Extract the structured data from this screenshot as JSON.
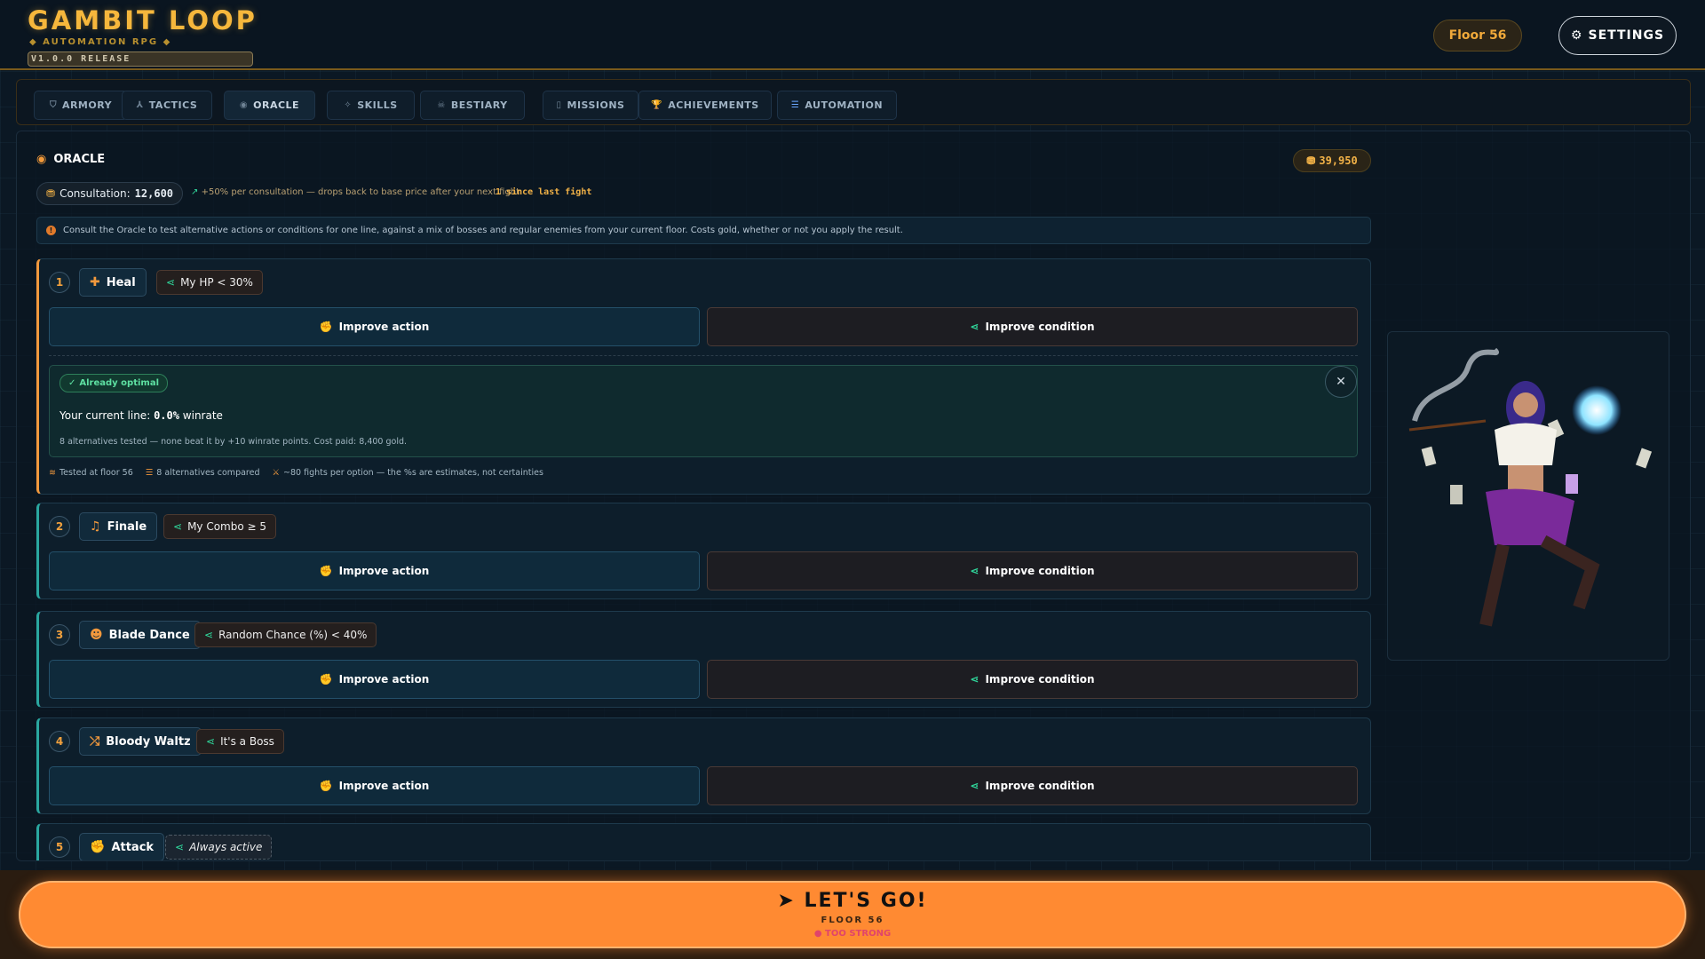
{
  "header": {
    "title": "GAMBIT LOOP",
    "subtitle": "◆ AUTOMATION RPG ◆",
    "version": "V1.0.0 RELEASE",
    "floor": "Floor 56",
    "settings_label": "SETTINGS"
  },
  "nav": {
    "tabs": [
      {
        "label": "ARMORY",
        "icon": "shield-icon"
      },
      {
        "label": "TACTICS",
        "icon": "branch-icon"
      },
      {
        "label": "ORACLE",
        "icon": "eye-icon"
      },
      {
        "label": "SKILLS",
        "icon": "sparkle-icon"
      },
      {
        "label": "BESTIARY",
        "icon": "skull-icon"
      },
      {
        "label": "MISSIONS",
        "icon": "scroll-icon"
      },
      {
        "label": "ACHIEVEMENTS",
        "icon": "trophy-icon"
      },
      {
        "label": "AUTOMATION",
        "icon": "sliders-icon"
      }
    ]
  },
  "oracle": {
    "title": "ORACLE",
    "gold": "39,950",
    "consultation_label": "Consultation:",
    "consultation_value": "12,600",
    "consultation_note": "+50% per consultation — drops back to base price after your next fight",
    "since": "1 since last fight",
    "info": "Consult the Oracle to test alternative actions or conditions for one line, against a mix of bosses and regular enemies from your current floor. Costs gold, whether or not you apply the result."
  },
  "lines": [
    {
      "num": "1",
      "action": "Heal",
      "action_icon": "medkit-icon",
      "condition": "My HP < 30%"
    },
    {
      "num": "2",
      "action": "Finale",
      "action_icon": "music-icon",
      "condition": "My Combo ≥ 5"
    },
    {
      "num": "3",
      "action": "Blade Dance",
      "action_icon": "mask-icon",
      "condition": "Random Chance (%) < 40%"
    },
    {
      "num": "4",
      "action": "Bloody Waltz",
      "action_icon": "shuffle-icon",
      "condition": "It's a Boss"
    },
    {
      "num": "5",
      "action": "Attack",
      "action_icon": "fist-icon",
      "condition": "Always active"
    }
  ],
  "buttons": {
    "improve_action": "Improve action",
    "improve_condition": "Improve condition"
  },
  "result": {
    "badge": "Already optimal",
    "current_label": "Your current line:",
    "current_value": "0.0%",
    "current_suffix": "winrate",
    "note": "8 alternatives tested — none beat it by +10 winrate points. Cost paid: 8,400 gold.",
    "meta_floor": "Tested at floor 56",
    "meta_alts": "8 alternatives compared",
    "meta_fights": "~80 fights per option — the %s are estimates, not certainties"
  },
  "go": {
    "label": "LET'S GO!",
    "floor": "FLOOR 56",
    "warning": "TOO STRONG"
  },
  "colors": {
    "accent": "#f2993d",
    "gold": "#f6b73c",
    "green": "#2fd59a",
    "go_button": "#ff8a32"
  }
}
